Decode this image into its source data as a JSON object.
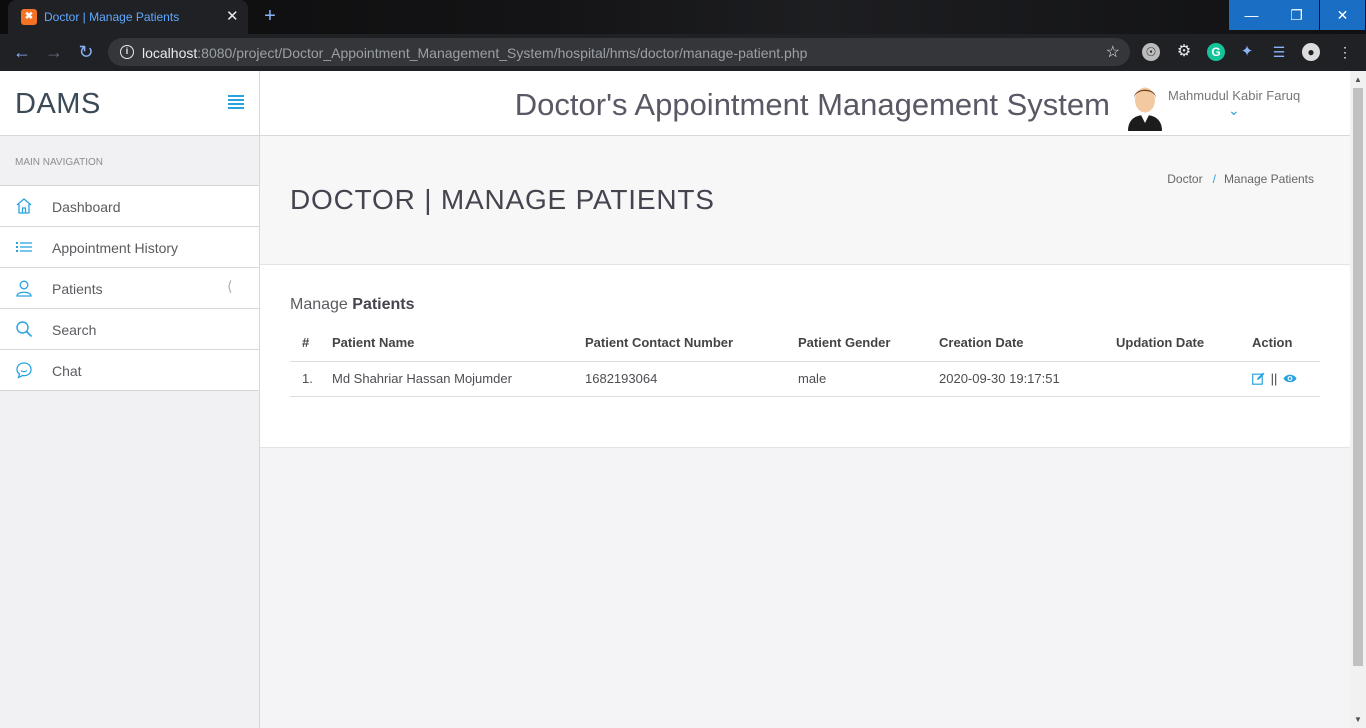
{
  "browser": {
    "tab_title": "Doctor | Manage Patients",
    "tab_favicon": "xampp-icon",
    "url_host": "localhost",
    "url_rest": ":8080/project/Doctor_Appointment_Management_System/hospital/hms/doctor/manage-patient.php",
    "window_controls": [
      "minimize-icon",
      "restore-icon",
      "close-icon"
    ]
  },
  "sidebar": {
    "brand": "DAMS",
    "nav_heading": "MAIN NAVIGATION",
    "items": [
      {
        "label": "Dashboard",
        "icon": "home-icon"
      },
      {
        "label": "Appointment History",
        "icon": "list-icon"
      },
      {
        "label": "Patients",
        "icon": "user-icon"
      },
      {
        "label": "Search",
        "icon": "search-icon"
      },
      {
        "label": "Chat",
        "icon": "chat-icon"
      }
    ]
  },
  "header": {
    "app_title": "Doctor's Appointment Management System",
    "user_name": "Mahmudul Kabir Faruq"
  },
  "page": {
    "title": "DOCTOR | MANAGE PATIENTS",
    "breadcrumb": [
      "Doctor",
      "Manage Patients"
    ]
  },
  "section": {
    "title_light": "Manage",
    "title_bold": "Patients"
  },
  "table": {
    "headers": [
      "#",
      "Patient Name",
      "Patient Contact Number",
      "Patient Gender",
      "Creation Date",
      "Updation Date",
      "Action"
    ],
    "rows": [
      [
        "1.",
        "Md Shahriar Hassan Mojumder",
        "1682193064",
        "male",
        "2020-09-30 19:17:51",
        ""
      ]
    ],
    "action_separator": "||"
  },
  "colors": {
    "accent": "#29a3e0",
    "browser_dark": "#202124",
    "window_button": "#1a6fc4"
  }
}
